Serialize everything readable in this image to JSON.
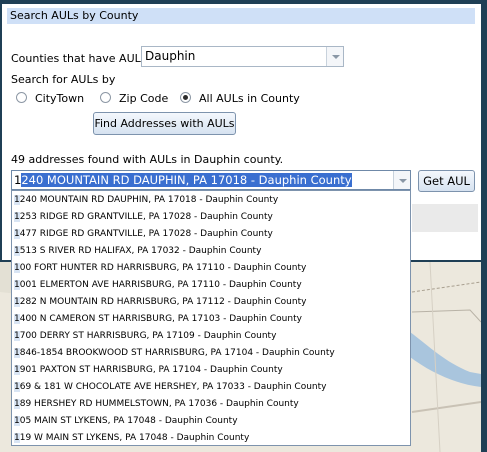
{
  "panel": {
    "title": "Search AULs by County",
    "counties_label": "Counties that have AULs:",
    "county_value": "Dauphin",
    "search_for_label": "Search for AULs by",
    "radios": [
      {
        "label": "CityTown",
        "checked": false
      },
      {
        "label": "Zip Code",
        "checked": false
      },
      {
        "label": "All AULs in County",
        "checked": true
      }
    ],
    "find_button": "Find Addresses with AULs",
    "results_summary": "49 addresses found with AULs in Dauphin county.",
    "selected_cursor_char": "1",
    "selected_rest": "240 MOUNTAIN RD DAUPHIN, PA 17018 - Dauphin County",
    "get_button": "Get AUL"
  },
  "dropdown": {
    "items": [
      {
        "first": "1",
        "rest": "240 MOUNTAIN RD DAUPHIN, PA 17018 - Dauphin County"
      },
      {
        "first": "1",
        "rest": "253 RIDGE RD GRANTVILLE, PA 17028 - Dauphin County"
      },
      {
        "first": "1",
        "rest": "477 RIDGE RD GRANTVILLE, PA 17028 - Dauphin County"
      },
      {
        "first": "1",
        "rest": "513 S RIVER RD HALIFAX, PA 17032 - Dauphin County"
      },
      {
        "first": "1",
        "rest": "00 FORT HUNTER RD HARRISBURG, PA 17110 - Dauphin County"
      },
      {
        "first": "1",
        "rest": "001 ELMERTON AVE HARRISBURG, PA 17110 - Dauphin County"
      },
      {
        "first": "1",
        "rest": "282 N MOUNTAIN RD HARRISBURG, PA 17112 - Dauphin County"
      },
      {
        "first": "1",
        "rest": "400 N CAMERON ST HARRISBURG, PA 17103 - Dauphin County"
      },
      {
        "first": "1",
        "rest": "700 DERRY ST HARRISBURG, PA 17109 - Dauphin County"
      },
      {
        "first": "1",
        "rest": "846-1854 BROOKWOOD ST HARRISBURG, PA 17104 - Dauphin County"
      },
      {
        "first": "1",
        "rest": "901 PAXTON ST HARRISBURG, PA 17104 - Dauphin County"
      },
      {
        "first": "1",
        "rest": "69 & 181 W CHOCOLATE AVE HERSHEY, PA 17033 - Dauphin County"
      },
      {
        "first": "1",
        "rest": "89 HERSHEY RD HUMMELSTOWN, PA 17036 - Dauphin County"
      },
      {
        "first": "1",
        "rest": "05 MAIN ST LYKENS, PA 17048 - Dauphin County"
      },
      {
        "first": "1",
        "rest": "19 W MAIN ST LYKENS, PA 17048 - Dauphin County"
      }
    ]
  }
}
